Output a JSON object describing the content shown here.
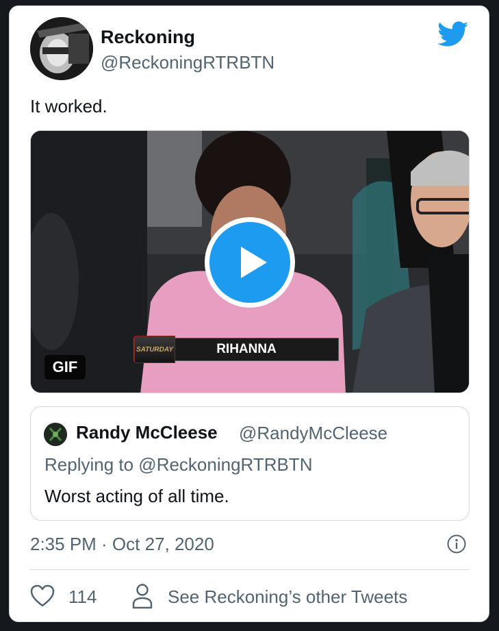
{
  "tweet": {
    "author_name": "Reckoning",
    "author_handle": "@ReckoningRTRBTN",
    "text": "It worked.",
    "media": {
      "badge": "GIF",
      "banner_logo": "SATURDAY",
      "banner_name": "RIHANNA",
      "play_icon": "play-icon"
    },
    "timestamp": "2:35 PM · Oct 27, 2020",
    "likes": "114",
    "other_tweets_label": "See Reckoning’s other Tweets"
  },
  "quoted_tweet": {
    "author_name": "Randy McCleese",
    "author_handle": "@RandyMcCleese",
    "reply_context": "Replying to @ReckoningRTRBTN",
    "text": "Worst acting of all time."
  },
  "colors": {
    "accent": "#1d9bf0",
    "text_primary": "#0f1419",
    "text_secondary": "#536471",
    "border": "#cfd9de",
    "page_background": "#15181c"
  },
  "icons": [
    "twitter-bird-icon",
    "play-icon",
    "info-icon",
    "heart-icon",
    "person-icon"
  ]
}
